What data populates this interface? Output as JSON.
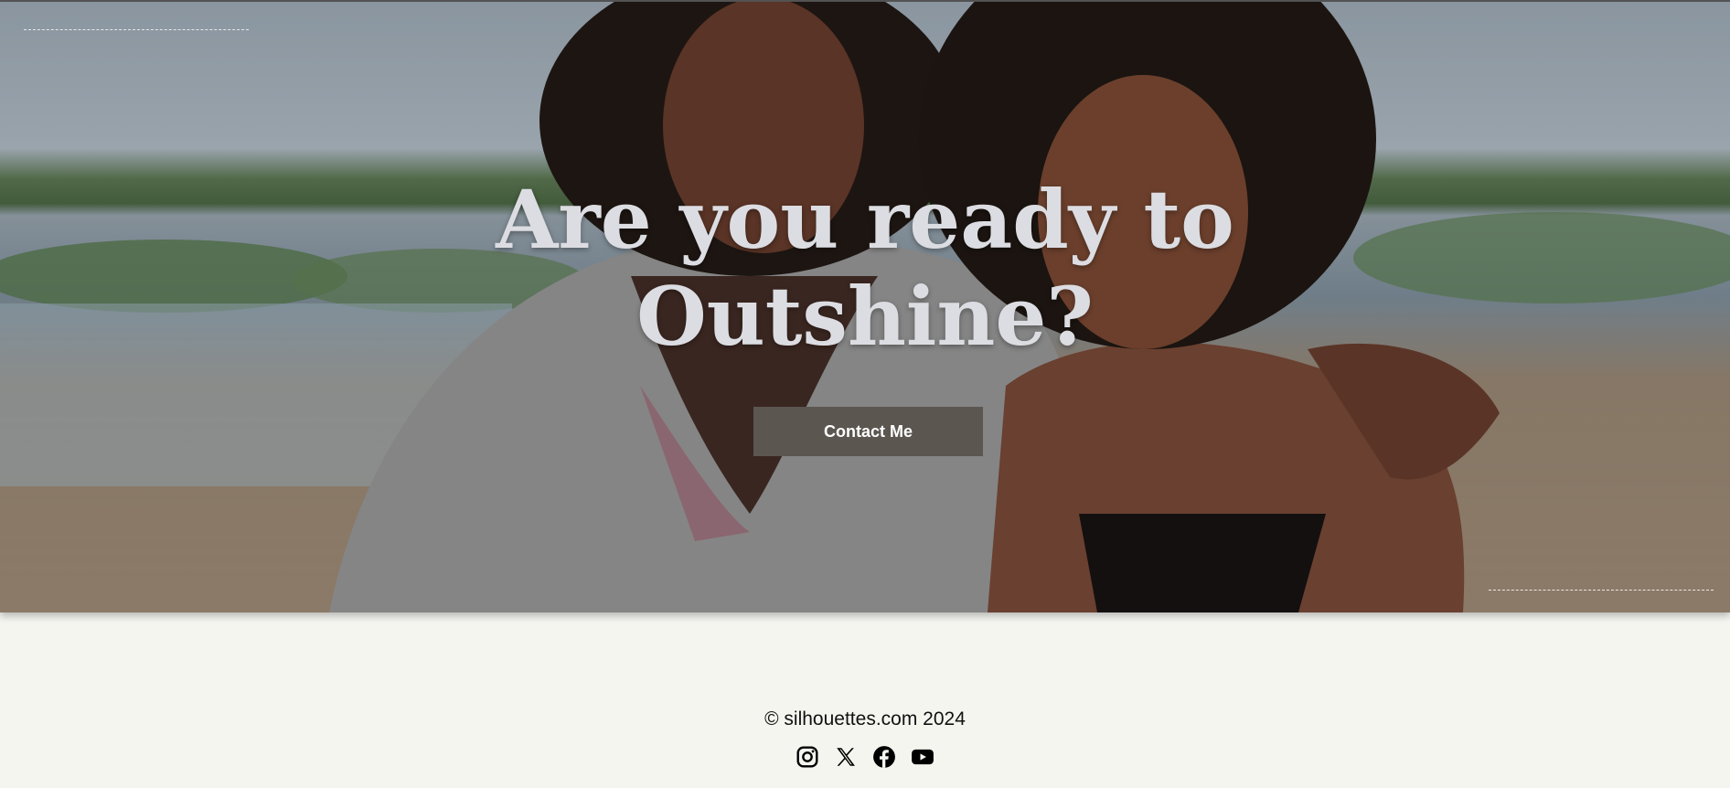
{
  "hero": {
    "headline_line1": "Are you ready to",
    "headline_line2": "Outshine?",
    "cta_label": "Contact Me"
  },
  "footer": {
    "copyright": "© silhouettes.com 2024",
    "social_icons": [
      "instagram-icon",
      "x-icon",
      "facebook-icon",
      "youtube-icon"
    ]
  },
  "colors": {
    "page_background": "#f5f5f0",
    "cta_background": "#5c5651",
    "headline_text": "#dcdde2"
  }
}
